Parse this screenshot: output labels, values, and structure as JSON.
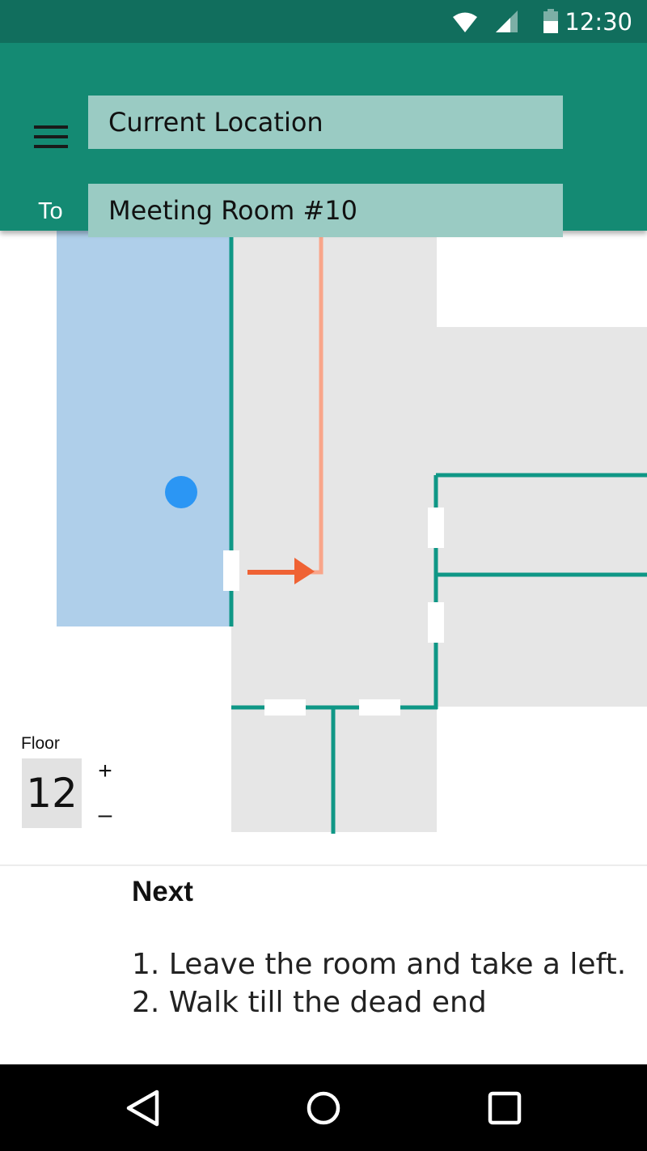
{
  "status_bar": {
    "time": "12:30",
    "icons": [
      "wifi-icon",
      "cell-signal-icon",
      "battery-icon"
    ]
  },
  "route": {
    "from_value": "Current Location",
    "to_label": "To",
    "to_value": "Meeting Room #10"
  },
  "floor": {
    "label": "Floor",
    "value": "12",
    "up_label": "+",
    "down_label": "–"
  },
  "directions": {
    "heading": "Next",
    "steps": [
      "1. Leave the room and take a left.",
      "2. Walk till the dead end"
    ]
  },
  "nav_bar": {
    "icons": [
      "back-icon",
      "home-icon",
      "recents-icon"
    ]
  },
  "colors": {
    "status_bar": "#116e5d",
    "app_bar": "#148a73",
    "input_fill": "#9acbc3",
    "wall": "#0f9786",
    "current_room": "#afcfea",
    "corridor": "#e6e6e6",
    "location_dot": "#2b96f4",
    "route_line": "#f9a58a",
    "route_arrow": "#ef6234"
  }
}
